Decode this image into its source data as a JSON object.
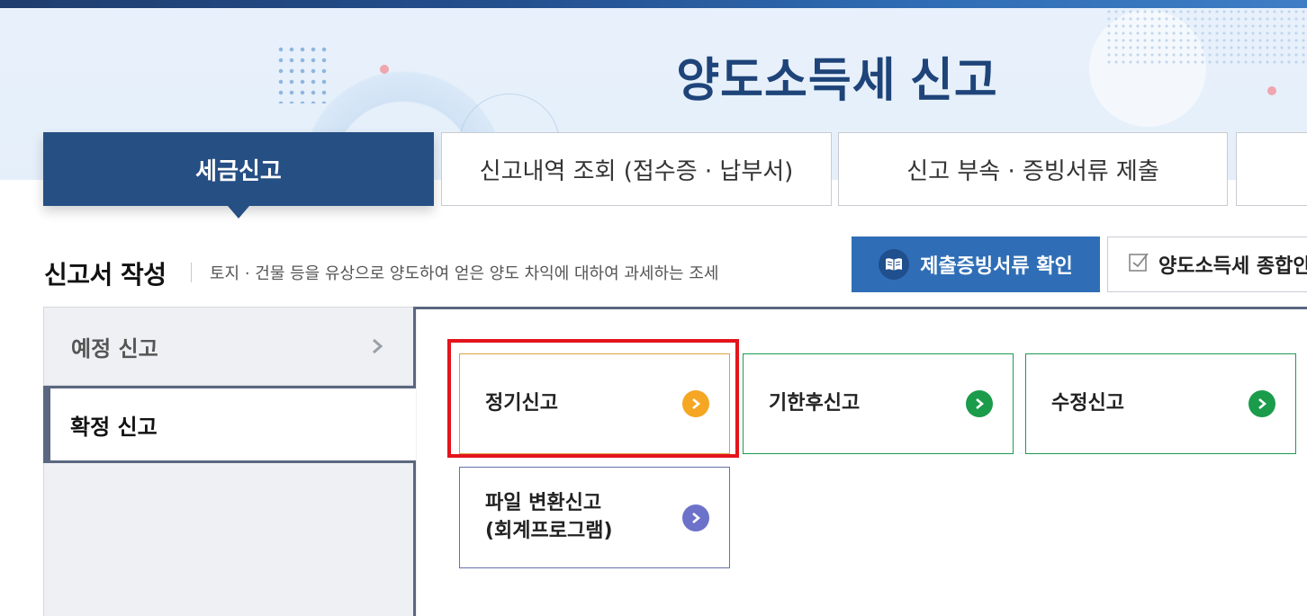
{
  "hero": {
    "title": "양도소득세  신고"
  },
  "tabs": [
    {
      "label": "세금신고",
      "active": true
    },
    {
      "label": "신고내역 조회 (접수증 · 납부서)",
      "active": false
    },
    {
      "label": "신고 부속 · 증빙서류 제출",
      "active": false
    }
  ],
  "section": {
    "title": "신고서 작성",
    "description": "토지 · 건물 등을 유상으로 양도하여 얻은 양도 차익에 대하여 과세하는 조세"
  },
  "buttons": {
    "check_documents": "제출증빙서류 확인",
    "overview": "양도소득세 종합안내"
  },
  "left_menu": [
    {
      "label": "예정 신고",
      "selected": false
    },
    {
      "label": "확정 신고",
      "selected": true
    }
  ],
  "cards": {
    "regular": "정기신고",
    "late": "기한후신고",
    "amend": "수정신고",
    "file_line1": "파일 변환신고",
    "file_line2": "(회계프로그램)"
  },
  "colors": {
    "primary_dark": "#264f83",
    "primary": "#2f6eb6",
    "orange_arrow": "#f5a623",
    "green_arrow": "#1a9c4a",
    "purple_arrow": "#6c72c9",
    "highlight": "#e3141c"
  },
  "icons": {
    "check_documents": "book-icon",
    "overview": "checkbox-icon",
    "menu_chevron": "chevron-right-icon",
    "card_arrow": "arrow-circle-right-icon"
  }
}
